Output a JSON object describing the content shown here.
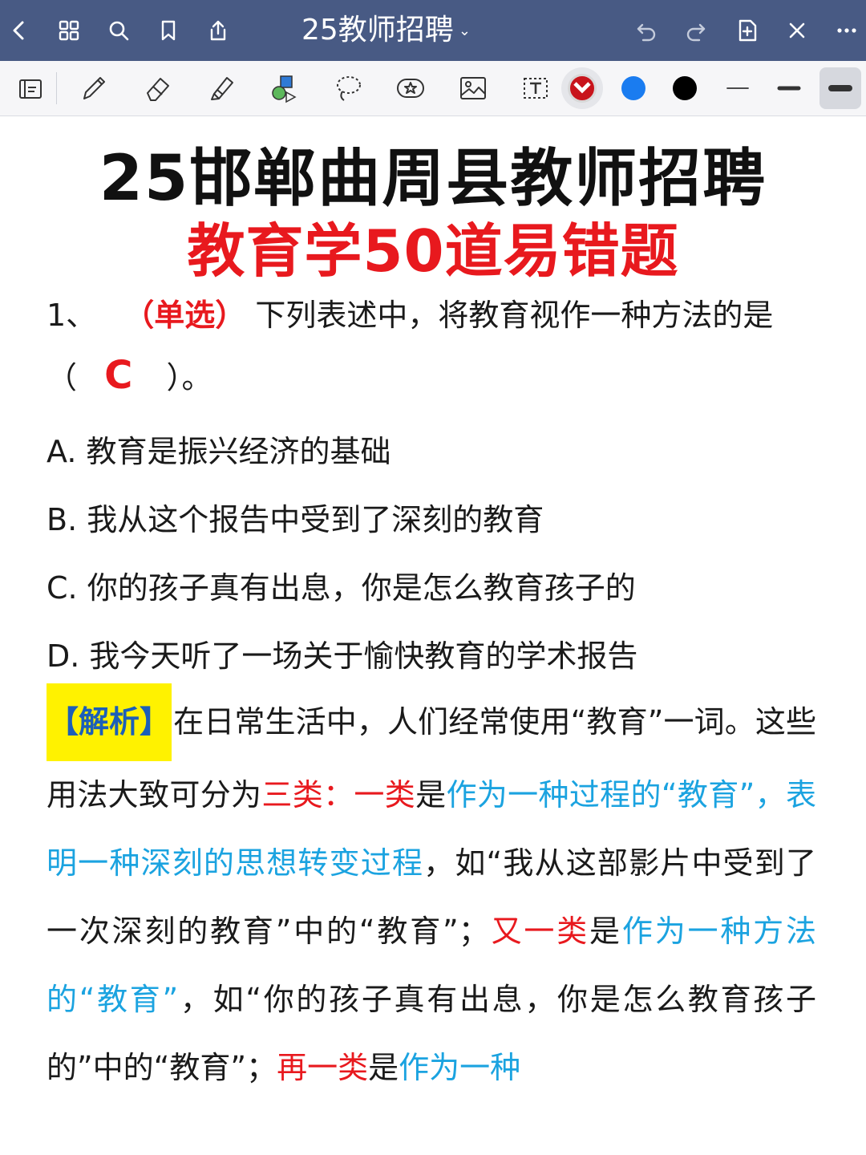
{
  "header": {
    "title": "25教师招聘",
    "title_caret": "⌄",
    "icons": [
      "back-icon",
      "grid-icon",
      "search-icon",
      "bookmark-icon",
      "share-icon",
      "undo-icon",
      "redo-icon",
      "add-page-icon",
      "close-icon",
      "more-icon"
    ]
  },
  "toolbar": {
    "tools": [
      "read-mode-icon",
      "pen-icon",
      "eraser-icon",
      "highlighter-icon",
      "shapes-icon",
      "lasso-icon",
      "sticker-icon",
      "image-icon",
      "text-icon"
    ],
    "colors": [
      "#c8141c",
      "#1a7cf0",
      "#000000"
    ],
    "selected_color": "#c8141c",
    "widths": [
      "thin",
      "medium",
      "thick"
    ],
    "selected_width": "thick"
  },
  "document": {
    "title": "25邯郸曲周县教师招聘",
    "subtitle": "教育学50道易错题",
    "question": {
      "number": "1、",
      "type": "（单选）",
      "stem": "下列表述中，将教育视作一种方法的是",
      "blank_open": "（",
      "answer": "C",
      "blank_close": "）。",
      "options": [
        "A.  教育是振兴经济的基础",
        "B.  我从这个报告中受到了深刻的教育",
        "C.  你的孩子真有出息，你是怎么教育孩子的",
        "D.  我今天听了一场关于愉快教育的学术报告"
      ]
    },
    "analysis": {
      "label": "【解析】",
      "segments": [
        {
          "text": "在日常生活中，人们经常使用“教育”一词。这些用法大致可分为",
          "color": "black"
        },
        {
          "text": "三类：一类",
          "color": "red"
        },
        {
          "text": "是",
          "color": "black"
        },
        {
          "text": "作为一种过程的“教育”，表明一种深刻的思想转变过程",
          "color": "blue"
        },
        {
          "text": "，如“我从这部影片中受到了一次深刻的教育”中的“教育”；",
          "color": "black"
        },
        {
          "text": "又一类",
          "color": "red"
        },
        {
          "text": "是",
          "color": "black"
        },
        {
          "text": "作为一种方法的“教育”",
          "color": "blue"
        },
        {
          "text": "，如“你的孩子真有出息，你是怎么教育孩子的”中的“教育”；",
          "color": "black"
        },
        {
          "text": "再一类",
          "color": "red"
        },
        {
          "text": "是",
          "color": "black"
        },
        {
          "text": "作为一种",
          "color": "blue"
        }
      ]
    }
  }
}
